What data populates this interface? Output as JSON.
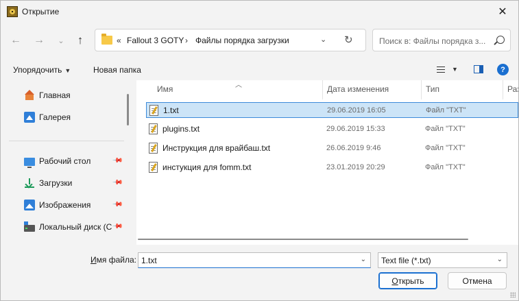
{
  "window": {
    "title": "Открытие"
  },
  "address": {
    "overflow": "«",
    "crumbs": [
      "Fallout 3 GOTY",
      "Файлы порядка загрузки"
    ],
    "separator": "›"
  },
  "search": {
    "placeholder": "Поиск в: Файлы порядка з..."
  },
  "toolbar": {
    "organize_label": "Упорядочить",
    "new_folder_label": "Новая папка"
  },
  "nav": {
    "items": [
      {
        "label": "Главная",
        "icon": "home-icon"
      },
      {
        "label": "Галерея",
        "icon": "gallery-icon"
      },
      {
        "label": "Рабочий стол",
        "icon": "desktop-icon",
        "pinned": true
      },
      {
        "label": "Загрузки",
        "icon": "downloads-icon",
        "pinned": true
      },
      {
        "label": "Изображения",
        "icon": "images-icon",
        "pinned": true
      },
      {
        "label": "Локальный диск (C",
        "icon": "disk-icon",
        "pinned": true
      }
    ]
  },
  "columns": {
    "name": "Имя",
    "date": "Дата изменения",
    "type": "Тип",
    "size": "Раз"
  },
  "files": [
    {
      "name": "1.txt",
      "date": "29.06.2019 16:05",
      "type": "Файл \"TXT\"",
      "selected": true
    },
    {
      "name": "plugins.txt",
      "date": "29.06.2019 15:33",
      "type": "Файл \"TXT\""
    },
    {
      "name": "Инструкция для врайбаш.txt",
      "date": "26.06.2019 9:46",
      "type": "Файл \"TXT\""
    },
    {
      "name": "инстукция для  fomm.txt",
      "date": "23.01.2019 20:29",
      "type": "Файл \"TXT\""
    }
  ],
  "filename": {
    "label_prefix": "И",
    "label_rest": "мя файла:",
    "value": "1.txt"
  },
  "filetype": {
    "value": "Text file (*.txt)"
  },
  "buttons": {
    "open_prefix": "О",
    "open_rest": "ткрыть",
    "cancel": "Отмена"
  }
}
